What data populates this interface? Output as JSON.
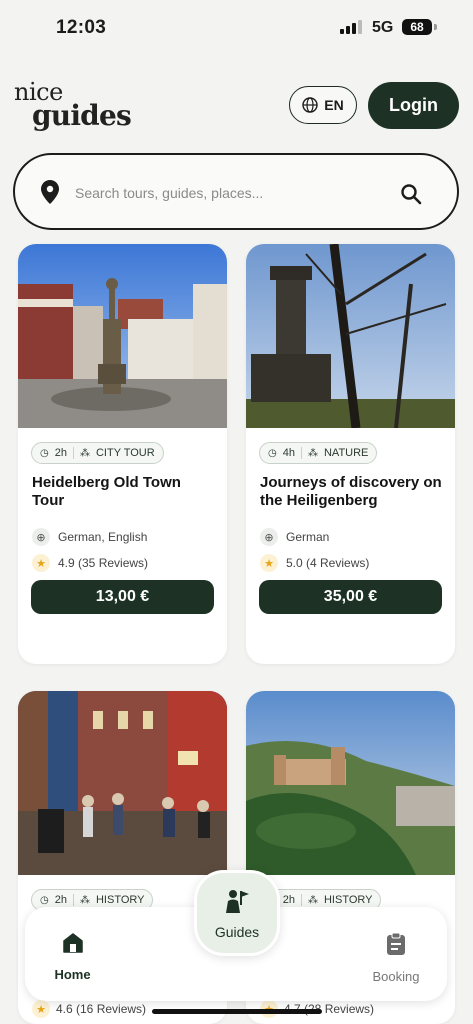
{
  "status_bar": {
    "time": "12:03",
    "network": "5G",
    "battery": "68"
  },
  "header": {
    "logo_line1": "nice",
    "logo_line2": "guides",
    "language_label": "EN",
    "login_label": "Login"
  },
  "search": {
    "placeholder": "Search tours, guides, places..."
  },
  "tours": [
    {
      "duration": "2h",
      "category": "CITY TOUR",
      "title": "Heidelberg Old Town Tour",
      "languages": "German, English",
      "rating": "4.9 (35 Reviews)",
      "price": "13,00 €"
    },
    {
      "duration": "4h",
      "category": "NATURE",
      "title": "Journeys of discovery on the Heiligenberg",
      "languages": "German",
      "rating": "5.0 (4 Reviews)",
      "price": "35,00 €"
    },
    {
      "duration": "2h",
      "category": "HISTORY",
      "rating": "4.6 (16 Reviews)"
    },
    {
      "duration": "2h",
      "category": "HISTORY",
      "rating": "4.7 (28 Reviews)"
    }
  ],
  "bottom_nav": {
    "home_label": "Home",
    "guides_label": "Guides",
    "booking_label": "Booking"
  },
  "colors": {
    "brand_dark_green": "#1d3225",
    "chip_background": "#f4f7f3",
    "page_background": "#f3f3f1",
    "star": "#e8a317"
  },
  "icons": [
    "location-pin-icon",
    "search-icon",
    "globe-icon",
    "clock-icon",
    "category-icon",
    "star-icon",
    "home-icon",
    "guide-flag-icon",
    "booking-clipboard-icon"
  ]
}
